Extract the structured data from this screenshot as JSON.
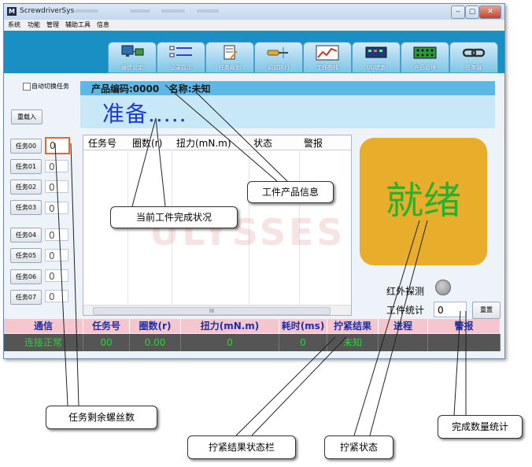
{
  "window": {
    "title": "ScrewdriverSys",
    "app_icon": "M",
    "controls": [
      "‒",
      "▢",
      "✕"
    ]
  },
  "menu": [
    "系统",
    "功能",
    "管理",
    "辅助工具",
    "信息"
  ],
  "toolbar": {
    "tabs": [
      {
        "label": "通信设定",
        "icon": "monitor-network-icon"
      },
      {
        "label": "记录显示",
        "icon": "list-records-icon"
      },
      {
        "label": "任务规划",
        "icon": "task-doc-icon"
      },
      {
        "label": "调试执行",
        "icon": "screwdriver-icon"
      },
      {
        "label": "工作曲线",
        "icon": "chart-curve-icon"
      },
      {
        "label": "I/O状态",
        "icon": "io-panel-icon"
      },
      {
        "label": "产品管理",
        "icon": "product-board-icon"
      },
      {
        "label": "任务链",
        "icon": "chain-link-icon"
      }
    ]
  },
  "left": {
    "auto_switch_label": "自动切换任务",
    "reload_label": "重载入",
    "tasks": [
      {
        "label": "任务00",
        "count": "0"
      },
      {
        "label": "任务01",
        "count": "0"
      },
      {
        "label": "任务02",
        "count": "0"
      },
      {
        "label": "任务03",
        "count": "0"
      },
      {
        "label": "任务04",
        "count": "0"
      },
      {
        "label": "任务05",
        "count": "0"
      },
      {
        "label": "任务06",
        "count": "0"
      },
      {
        "label": "任务07",
        "count": "0"
      }
    ]
  },
  "product": {
    "info": "产品编码:0000   名称:未知"
  },
  "status": {
    "text": "准备....."
  },
  "table": {
    "headers": [
      "任务号",
      "圈数(r)",
      "扭力(mN.m)",
      "状态",
      "警报"
    ],
    "scroll_marker": "III"
  },
  "ready": {
    "text": "就绪"
  },
  "right": {
    "ir_label": "红外探测",
    "count_label": "工件统计",
    "count_value": "0",
    "reset_label": "重置"
  },
  "statusbar": {
    "headers": [
      "通信",
      "任务号",
      "圈数(r)",
      "扭力(mN.m)",
      "耗时(ms)",
      "拧紧结果",
      "进程",
      "警报"
    ],
    "values": [
      "连接正常",
      "00",
      "0.00",
      "0",
      "0",
      "未知",
      "",
      ""
    ]
  },
  "watermark": "ULYSSES",
  "callouts": {
    "product_info": "工件产品信息",
    "completion": "当前工件完成状况",
    "remaining": "任务剩余螺丝数",
    "result_bar": "拧紧结果状态栏",
    "tighten_state": "拧紧状态",
    "count_stat": "完成数量统计"
  },
  "colors": {
    "toolband": "#1a8fc4",
    "ready_bg": "#e8ad2a",
    "ready_text": "#27b12f",
    "status_text": "#1c3bd6",
    "ok_text": "#22d82a"
  }
}
